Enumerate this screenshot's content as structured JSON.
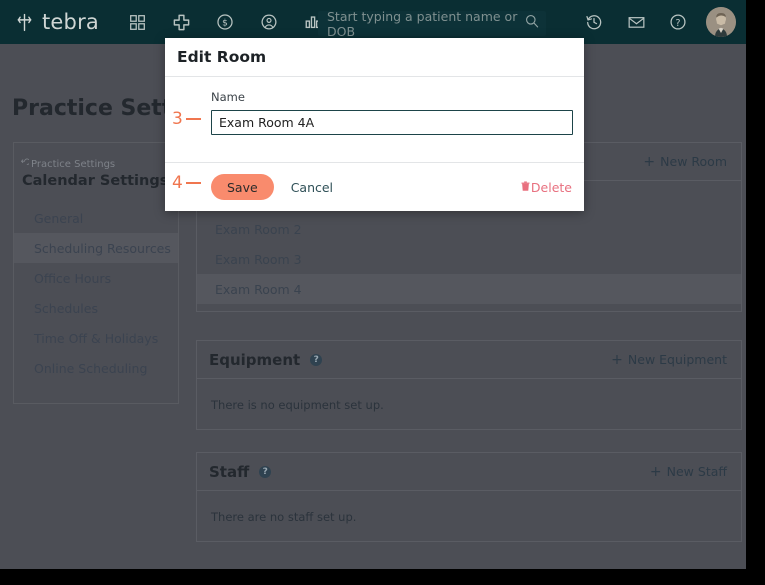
{
  "topbar": {
    "brand": "tebra",
    "logo_icon": "tebra-leaf-icon",
    "nav_icons": [
      {
        "name": "dashboard-grid-icon",
        "glyph": "grid"
      },
      {
        "name": "plus-cross-icon",
        "glyph": "cross"
      },
      {
        "name": "dollar-circle-icon",
        "glyph": "dollar"
      },
      {
        "name": "patient-circle-icon",
        "glyph": "patient"
      },
      {
        "name": "reports-bar-icon",
        "glyph": "bars"
      }
    ],
    "search": {
      "placeholder": "Start typing a patient name or DOB",
      "value": "",
      "icon": "search-icon"
    },
    "right_icons": [
      {
        "name": "history-clock-icon",
        "glyph": "history"
      },
      {
        "name": "mail-envelope-icon",
        "glyph": "mail"
      },
      {
        "name": "help-question-icon",
        "glyph": "help"
      }
    ],
    "avatar": "user-avatar"
  },
  "page": {
    "title": "Practice Settings"
  },
  "sidebar": {
    "breadcrumb": "Practice Settings",
    "breadcrumb_icon": "back-arrow-icon",
    "section_title": "Calendar Settings",
    "items": [
      {
        "label": "General",
        "active": false
      },
      {
        "label": "Scheduling Resources",
        "active": true
      },
      {
        "label": "Office Hours",
        "active": false
      },
      {
        "label": "Schedules",
        "active": false
      },
      {
        "label": "Time Off & Holidays",
        "active": false
      },
      {
        "label": "Online Scheduling",
        "active": false
      }
    ]
  },
  "main": {
    "rooms_card": {
      "action_label": "New Room",
      "action_icon": "plus-icon",
      "rows": [
        {
          "label": "Exam Room 2",
          "highlight": false
        },
        {
          "label": "Exam Room 3",
          "highlight": false
        },
        {
          "label": "Exam Room 4",
          "highlight": true
        }
      ]
    },
    "equipment_card": {
      "title": "Equipment",
      "help_icon": "help-question-icon",
      "help_glyph": "?",
      "action_label": "New Equipment",
      "action_icon": "plus-icon",
      "empty_message": "There is no equipment set up."
    },
    "staff_card": {
      "title": "Staff",
      "help_icon": "help-question-icon",
      "help_glyph": "?",
      "action_label": "New Staff",
      "action_icon": "plus-icon",
      "empty_message": "There are no staff set up."
    }
  },
  "modal": {
    "title": "Edit Room",
    "field_label": "Name",
    "input_value": "Exam Room 4A",
    "save_label": "Save",
    "cancel_label": "Cancel",
    "delete_label": "Delete",
    "delete_icon": "trash-icon"
  },
  "annotations": [
    {
      "number": "3",
      "target": "name-input"
    },
    {
      "number": "4",
      "target": "save-button"
    }
  ],
  "colors": {
    "topbar_bg": "#0a2e33",
    "page_bg": "#4c4e55",
    "accent_orange": "#f98b6d",
    "annotation_orange": "#f0764f",
    "delete_red": "#e8707f",
    "input_border": "#1d4449"
  }
}
